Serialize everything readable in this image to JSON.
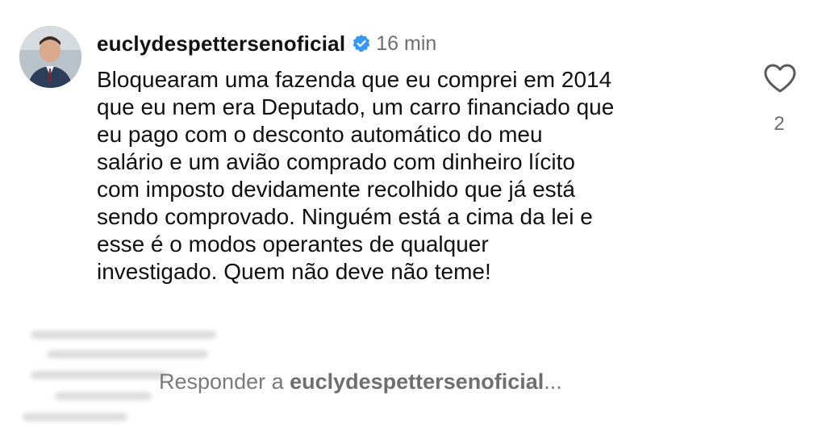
{
  "comment": {
    "username": "euclydespettersenoficial",
    "verified_icon": "verified-badge-icon",
    "time": "16 min",
    "lines": [
      "Bloquearam uma fazenda que eu comprei em 2014",
      "que eu nem era Deputado, um carro financiado que",
      "eu pago com o desconto automático do meu",
      "salário e um avião comprado com dinheiro lícito",
      "com imposto devidamente recolhido que já está",
      "sendo comprovado. Ninguém está a cima da lei e",
      "esse é o modos operantes de qualquer",
      "investigado. Quem não deve não teme!"
    ],
    "like_icon": "heart-icon",
    "like_count": "2"
  },
  "reply_bar": {
    "prefix": "Responder a ",
    "username": "euclydespettersenoficial",
    "suffix": "..."
  },
  "colors": {
    "verified": "#3897f0",
    "muted": "#6e6e6e"
  }
}
